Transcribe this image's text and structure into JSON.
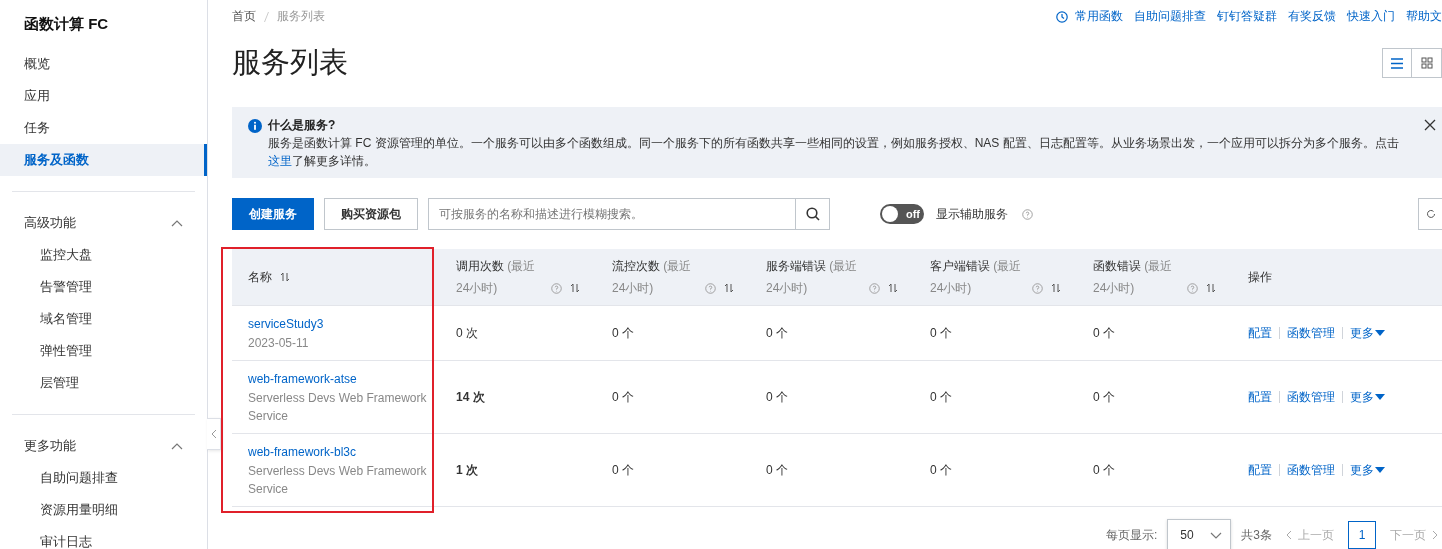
{
  "sidebar": {
    "title": "函数计算 FC",
    "items": [
      {
        "label": "概览",
        "selected": false
      },
      {
        "label": "应用",
        "selected": false
      },
      {
        "label": "任务",
        "selected": false
      },
      {
        "label": "服务及函数",
        "selected": true
      }
    ],
    "sections": [
      {
        "title": "高级功能",
        "expanded": true,
        "items": [
          {
            "label": "监控大盘"
          },
          {
            "label": "告警管理"
          },
          {
            "label": "域名管理"
          },
          {
            "label": "弹性管理"
          },
          {
            "label": "层管理"
          }
        ]
      },
      {
        "title": "更多功能",
        "expanded": true,
        "items": [
          {
            "label": "自助问题排查"
          },
          {
            "label": "资源用量明细"
          },
          {
            "label": "审计日志"
          }
        ]
      }
    ]
  },
  "breadcrumb": [
    {
      "label": "首页",
      "current": false
    },
    {
      "label": "服务列表",
      "current": true
    }
  ],
  "top_links": [
    "常用函数",
    "自助问题排查",
    "钉钉答疑群",
    "有奖反馈",
    "快速入门",
    "帮助文"
  ],
  "page_title": "服务列表",
  "view_toggle": [
    {
      "kind": "list",
      "selected": true
    },
    {
      "kind": "grid",
      "selected": false
    }
  ],
  "notice": {
    "title": "什么是服务?",
    "text": "服务是函数计算 FC 资源管理的单位。一个服务可以由多个函数组成。同一个服务下的所有函数共享一些相同的设置，例如服务授权、NAS 配置、日志配置等。从业务场景出发，一个应用可以拆分为多个服务。点击",
    "link": "这里",
    "text_after": "了解更多详情。"
  },
  "toolbar": {
    "buttons": [
      {
        "label": "创建服务",
        "kind": "primary"
      },
      {
        "label": "购买资源包",
        "kind": "default"
      }
    ],
    "search": {
      "placeholder": "可按服务的名称和描述进行模糊搜索。"
    },
    "toggle": {
      "on": false,
      "label": "off"
    },
    "toggle_label": "显示辅助服务"
  },
  "table": {
    "name_column_outlined": true,
    "columns": [
      {
        "title": "名称",
        "sortable": true
      },
      {
        "title": "调用次数",
        "hint": "(最近24小时)",
        "help": true,
        "sortable": true
      },
      {
        "title": "流控次数",
        "hint": "(最近24小时)",
        "help": true,
        "sortable": true
      },
      {
        "title": "服务端错误",
        "hint": "(最近24小时)",
        "help": true,
        "sortable": true
      },
      {
        "title": "客户端错误",
        "hint": "(最近24小时)",
        "help": true,
        "sortable": true
      },
      {
        "title": "函数错误",
        "hint": "(最近24小时)",
        "help": true,
        "sortable": true
      },
      {
        "title": "操作"
      }
    ],
    "rows": [
      {
        "name": "serviceStudy3",
        "description": "2023-05-11",
        "invocations": "0 次",
        "invocations_bold": false,
        "throttles": "0 个",
        "server_errors": "0 个",
        "client_errors": "0 个",
        "function_errors": "0 个",
        "actions": [
          "配置",
          "函数管理",
          "更多"
        ]
      },
      {
        "name": "web-framework-atse",
        "description": "Serverless Devs Web Framework Service",
        "invocations": "14 次",
        "invocations_bold": true,
        "throttles": "0 个",
        "server_errors": "0 个",
        "client_errors": "0 个",
        "function_errors": "0 个",
        "actions": [
          "配置",
          "函数管理",
          "更多"
        ]
      },
      {
        "name": "web-framework-bl3c",
        "description": "Serverless Devs Web Framework Service",
        "invocations": "1 次",
        "invocations_bold": true,
        "throttles": "0 个",
        "server_errors": "0 个",
        "client_errors": "0 个",
        "function_errors": "0 个",
        "actions": [
          "配置",
          "函数管理",
          "更多"
        ]
      }
    ]
  },
  "pagination": {
    "page_size_label": "每页显示:",
    "page_size": "50",
    "total": "共3条",
    "prev": {
      "label": "上一页",
      "disabled": true
    },
    "pages": [
      {
        "label": "1",
        "selected": true
      }
    ],
    "next": {
      "label": "下一页",
      "disabled": true
    }
  }
}
